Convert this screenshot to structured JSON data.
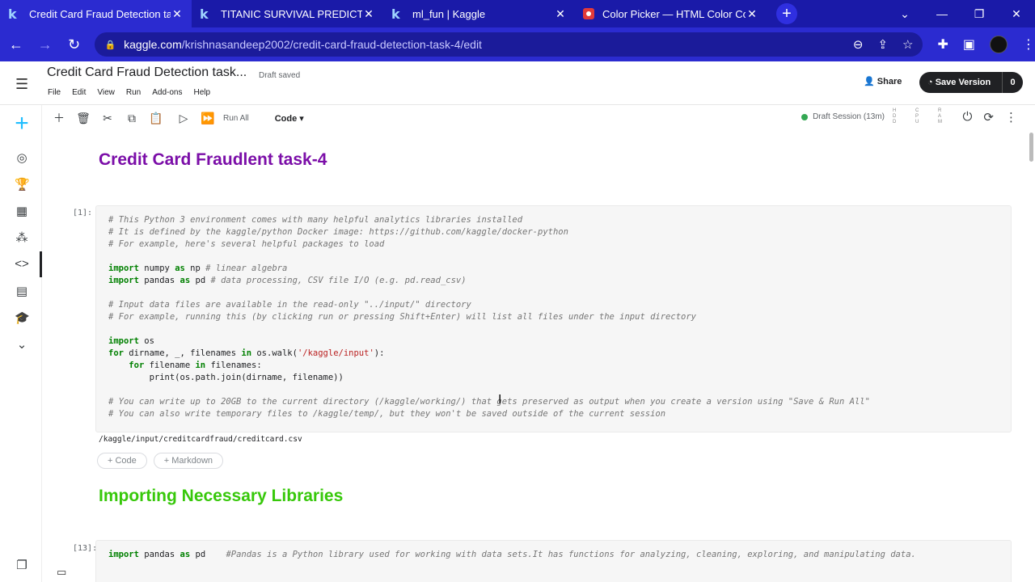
{
  "browser": {
    "tabs": [
      {
        "title": "Credit Card Fraud Detection task",
        "icon": "kaggle-k",
        "active": true
      },
      {
        "title": "TITANIC SURVIVAL PREDICTION(",
        "icon": "kaggle-k",
        "active": false
      },
      {
        "title": "ml_fun | Kaggle",
        "icon": "kaggle-k",
        "active": false
      },
      {
        "title": "Color Picker — HTML Color Code",
        "icon": "color-picker",
        "active": false
      }
    ],
    "url_host": "kaggle.com",
    "url_path": "/krishnasandeep2002/credit-card-fraud-detection-task-4/edit"
  },
  "header": {
    "notebook_title": "Credit Card Fraud Detection task...",
    "draft_status": "Draft saved",
    "menu": [
      "File",
      "Edit",
      "View",
      "Run",
      "Add-ons",
      "Help"
    ],
    "share_label": "Share",
    "save_version_label": "Save Version",
    "save_version_count": "0"
  },
  "toolbar": {
    "run_all_label": "Run All",
    "cell_type": "Code",
    "session_label": "Draft Session (13m)",
    "meters": [
      "H D D",
      "C P U",
      "R A M"
    ]
  },
  "notebook": {
    "heading1": "Credit Card Fraudlent task-4",
    "cell1_number": "[1]:",
    "cell1_output": "/kaggle/input/creditcardfraud/creditcard.csv",
    "add_code_label": "+ Code",
    "add_markdown_label": "+ Markdown",
    "heading2": "Importing Necessary Libraries",
    "cell2_number": "[13]:"
  },
  "colors": {
    "heading1": "#7b0ea8",
    "heading2": "#37c80a",
    "accent": "#20beff"
  }
}
